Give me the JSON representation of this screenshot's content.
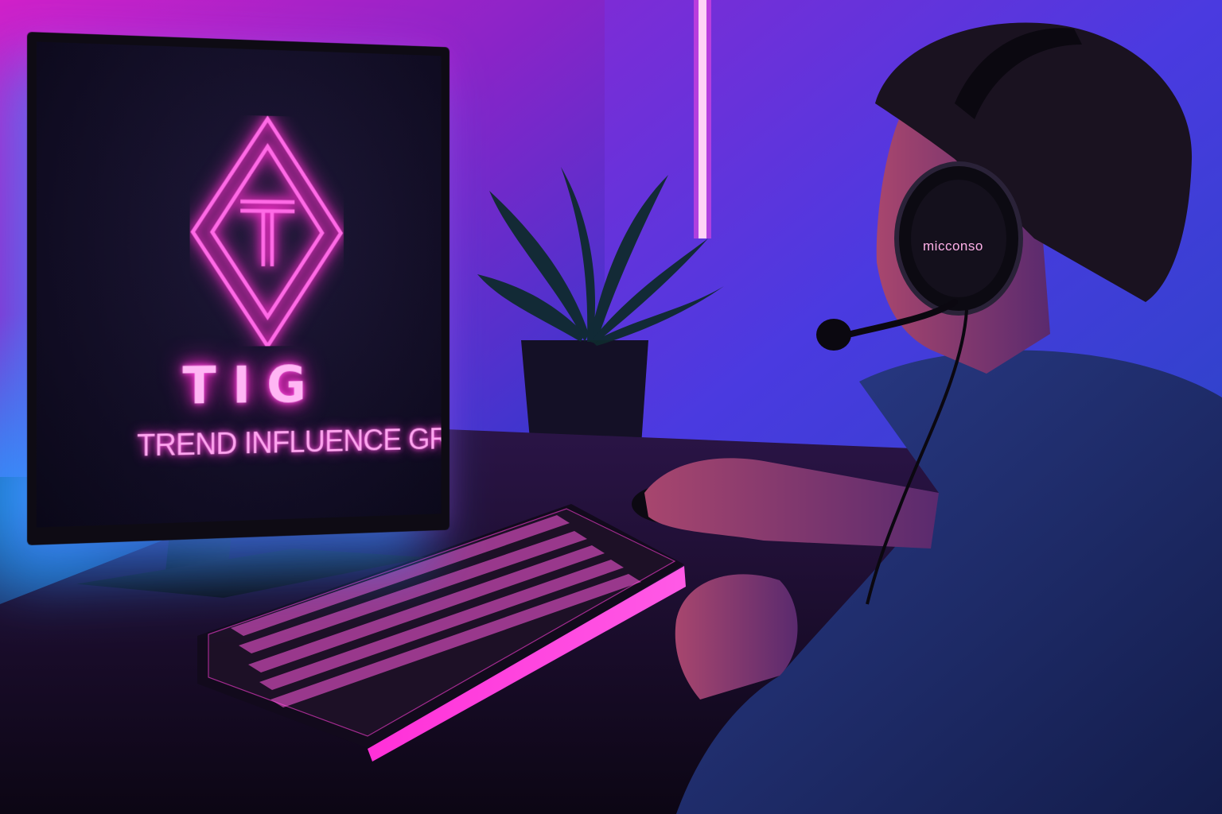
{
  "monitor": {
    "logo_letter": "T",
    "logo_abbreviation": "TIG",
    "logo_name": "TREND INFLUENCE GROUP"
  },
  "headset": {
    "brand": "micconso"
  },
  "colors": {
    "neon_pink": "#ff2fd0",
    "neon_blue": "#2a8cff",
    "room_purple": "#6a1fb0"
  }
}
